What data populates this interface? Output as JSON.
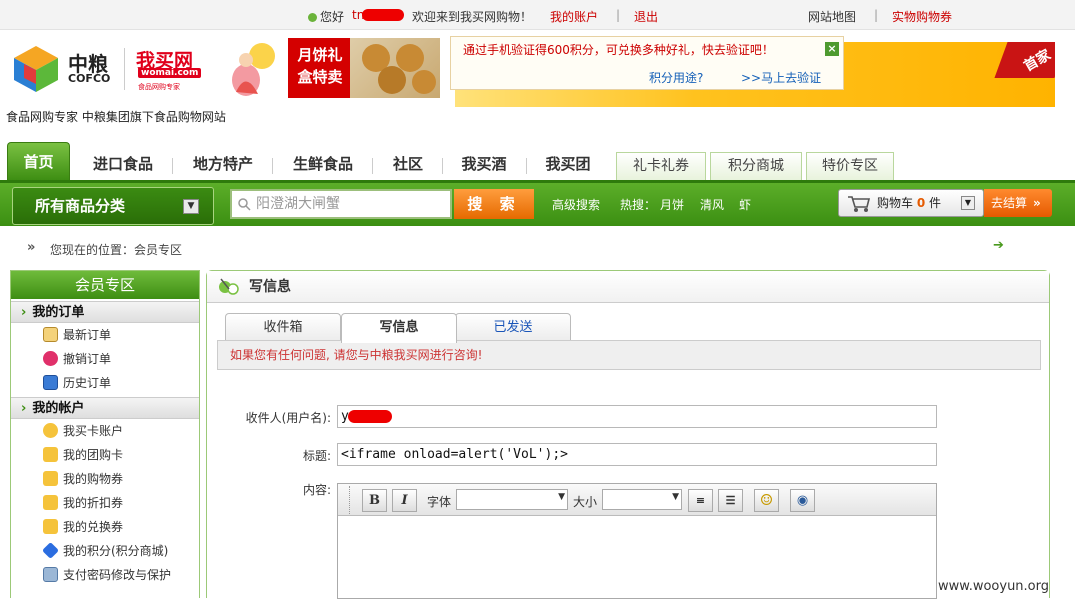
{
  "top": {
    "greeting": "您好",
    "user_fragment": "tn",
    "welcome": "欢迎来到我买网购物！",
    "account": "我的账户",
    "logout": "退出",
    "sitemap": "网站地图",
    "coupon": "实物购物券"
  },
  "header": {
    "brand_cn": "中粮",
    "brand_en": "COFCO",
    "brand2": "我买网",
    "brand2_en": "womai.com",
    "brand2_sub": "食品网购专家",
    "banner1": "月饼礼盒特卖",
    "banner2_badge": "首家",
    "popup_text": "通过手机验证得600积分，可兑换多种好礼，快去验证吧！",
    "popup_link1": "积分用途?",
    "popup_link2": ">>马上去验证",
    "tagline": "食品网购专家  中粮集团旗下食品购物网站"
  },
  "nav": {
    "tabs": [
      "首页",
      "进口食品",
      "地方特产",
      "生鲜食品",
      "社区",
      "我买酒",
      "我买团"
    ],
    "subtabs": [
      "礼卡礼券",
      "积分商城",
      "特价专区"
    ]
  },
  "searchbar": {
    "category": "所有商品分类",
    "placeholder": "阳澄湖大闸蟹",
    "button": "搜 索",
    "advanced": "高级搜索",
    "hot_label": "热搜：",
    "hot": [
      "月饼",
      "清风",
      "虾"
    ],
    "cart_label": "购物车",
    "cart_count": "0",
    "cart_unit": "件",
    "checkout": "去结算"
  },
  "breadcrumb": "您现在的位置：会员专区",
  "sidebar": {
    "title": "会员专区",
    "sections": [
      {
        "title": "我的订单",
        "items": [
          "最新订单",
          "撤销订单",
          "历史订单"
        ]
      },
      {
        "title": "我的帐户",
        "items": [
          "我买卡账户",
          "我的团购卡",
          "我的购物券",
          "我的折扣券",
          "我的兑换券",
          "我的积分(积分商城)",
          "支付密码修改与保护"
        ]
      }
    ]
  },
  "main": {
    "title": "写信息",
    "tabs": [
      "收件箱",
      "写信息",
      "已发送"
    ],
    "active_tab": "写信息",
    "notice": "如果您有任何问题, 请您与中粮我买网进行咨询!",
    "recipient_label": "收件人(用户名):",
    "recipient_value": "y",
    "subject_label": "标题:",
    "subject_value": "<iframe onload=alert('VoL');>",
    "content_label": "内容:",
    "editor": {
      "bold": "B",
      "italic": "I",
      "font_label": "字体",
      "size_label": "大小"
    }
  },
  "watermark": "www.wooyun.org",
  "colors": {
    "green": "#3e8e13",
    "orange": "#e56a00",
    "red": "#cc0000"
  }
}
